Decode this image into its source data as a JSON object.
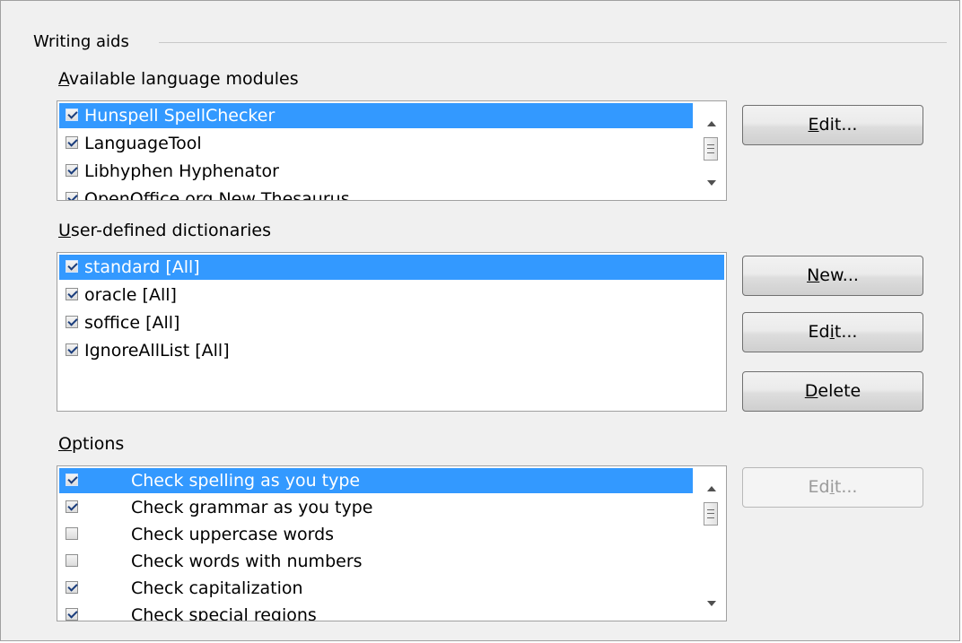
{
  "writing_aids": {
    "title": "Writing aids",
    "modules": {
      "label_accel": "A",
      "label_rest": "vailable language modules",
      "items": [
        {
          "label": "Hunspell SpellChecker",
          "checked": true,
          "selected": true
        },
        {
          "label": "LanguageTool",
          "checked": true,
          "selected": false
        },
        {
          "label": "Libhyphen Hyphenator",
          "checked": true,
          "selected": false
        },
        {
          "label": "OpenOffice.org New Thesaurus",
          "checked": true,
          "selected": false
        }
      ],
      "edit_pre": "",
      "edit_accel": "E",
      "edit_post": "dit..."
    },
    "dictionaries": {
      "label_accel": "U",
      "label_rest": "ser-defined dictionaries",
      "items": [
        {
          "label": "standard [All]",
          "checked": true,
          "selected": true
        },
        {
          "label": "oracle [All]",
          "checked": true,
          "selected": false
        },
        {
          "label": "soffice [All]",
          "checked": true,
          "selected": false
        },
        {
          "label": "IgnoreAllList [All]",
          "checked": true,
          "selected": false
        }
      ],
      "new_pre": "",
      "new_accel": "N",
      "new_post": "ew...",
      "edit_pre": "Ed",
      "edit_accel": "i",
      "edit_post": "t...",
      "delete_pre": "",
      "delete_accel": "D",
      "delete_post": "elete"
    },
    "options": {
      "label_accel": "O",
      "label_rest": "ptions",
      "items": [
        {
          "label": "Check spelling as you type",
          "checked": true,
          "selected": true
        },
        {
          "label": "Check grammar as you type",
          "checked": true,
          "selected": false
        },
        {
          "label": "Check uppercase words",
          "checked": false,
          "selected": false
        },
        {
          "label": "Check words with numbers",
          "checked": false,
          "selected": false
        },
        {
          "label": "Check capitalization",
          "checked": true,
          "selected": false
        },
        {
          "label": "Check special regions",
          "checked": true,
          "selected": false
        }
      ],
      "edit_pre": "Ed",
      "edit_accel": "i",
      "edit_post": "t..."
    }
  }
}
